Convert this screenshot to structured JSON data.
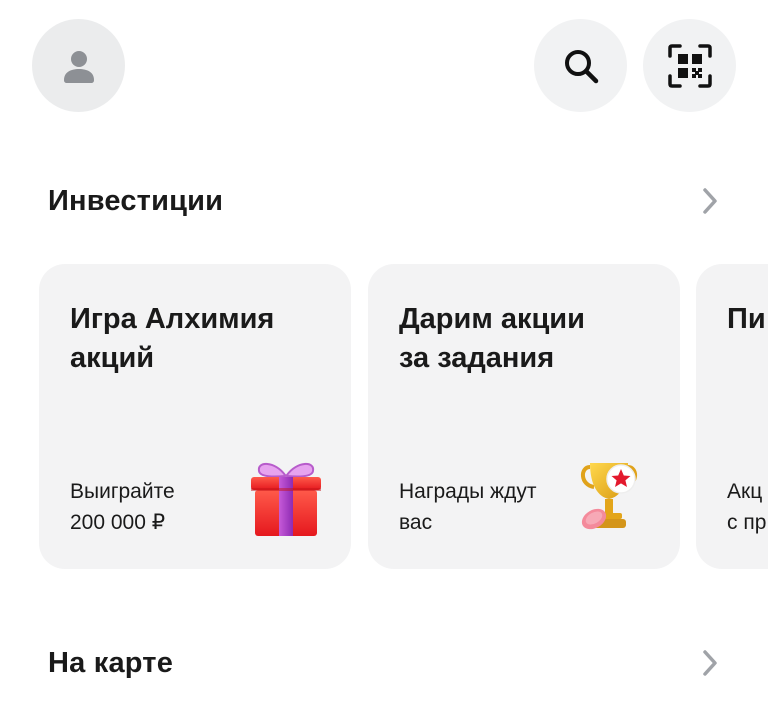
{
  "header": {
    "avatar_icon": "user-icon",
    "search_icon": "search-icon",
    "qr_icon": "qr-scan-icon"
  },
  "sections": [
    {
      "title": "Инвестиции"
    },
    {
      "title": "На карте"
    }
  ],
  "cards": [
    {
      "title_line1": "Игра Алхимия",
      "title_line2": "акций",
      "sub_line1": "Выиграйте",
      "sub_line2": "200 000 ₽",
      "icon": "gift-icon"
    },
    {
      "title_line1": "Дарим акции",
      "title_line2": "за задания",
      "sub_line1": "Награды ждут",
      "sub_line2": "вас",
      "icon": "trophy-icon"
    },
    {
      "title_line1": "Пи",
      "title_line2": "",
      "sub_line1": "Акц",
      "sub_line2": "с пр",
      "icon": ""
    }
  ],
  "colors": {
    "card_bg": "#f3f3f4",
    "button_bg": "#f1f2f3",
    "chevron": "#a0a3a8"
  }
}
